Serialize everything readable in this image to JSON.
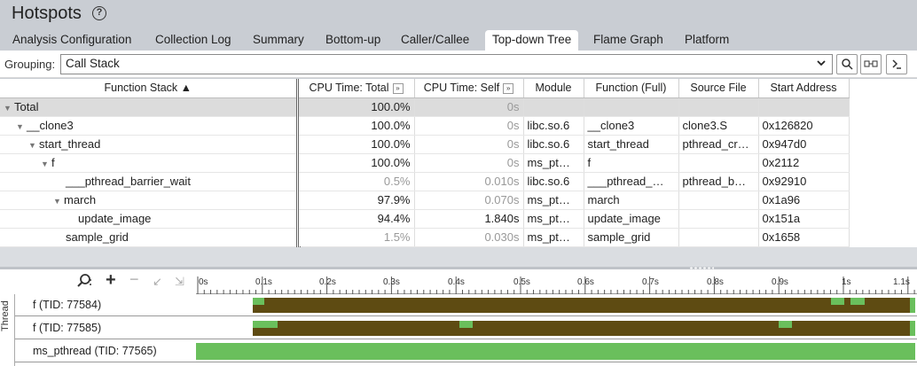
{
  "app": {
    "title": "Hotspots",
    "help_icon": "?"
  },
  "tabs": [
    {
      "label": "Analysis Configuration"
    },
    {
      "label": "Collection Log"
    },
    {
      "label": "Summary"
    },
    {
      "label": "Bottom-up"
    },
    {
      "label": "Caller/Callee"
    },
    {
      "label": "Top-down Tree",
      "active": true
    },
    {
      "label": "Flame Graph"
    },
    {
      "label": "Platform"
    }
  ],
  "grouping": {
    "label": "Grouping:",
    "value": "Call Stack"
  },
  "grid": {
    "columns": [
      "Function Stack ▲",
      "CPU Time: Total",
      "CPU Time: Self",
      "Module",
      "Function (Full)",
      "Source File",
      "Start Address"
    ],
    "expand_glyph": "»",
    "rows": [
      {
        "name": "Total",
        "total": "100.0%",
        "self": "0s",
        "module": "",
        "function": "",
        "source": "",
        "address": ""
      },
      {
        "name": "__clone3",
        "total": "100.0%",
        "self": "0s",
        "module": "libc.so.6",
        "function": "__clone3",
        "source": "clone3.S",
        "address": "0x126820"
      },
      {
        "name": "start_thread",
        "total": "100.0%",
        "self": "0s",
        "module": "libc.so.6",
        "function": "start_thread",
        "source": "pthread_cr…",
        "address": "0x947d0"
      },
      {
        "name": "f",
        "total": "100.0%",
        "self": "0s",
        "module": "ms_pt…",
        "function": "f",
        "source": "",
        "address": "0x2112"
      },
      {
        "name": "___pthread_barrier_wait",
        "total": "0.5%",
        "self": "0.010s",
        "module": "libc.so.6",
        "function": "___pthread_…",
        "source": "pthread_b…",
        "address": "0x92910"
      },
      {
        "name": "march",
        "total": "97.9%",
        "self": "0.070s",
        "module": "ms_pt…",
        "function": "march",
        "source": "",
        "address": "0x1a96"
      },
      {
        "name": "update_image",
        "total": "94.4%",
        "self": "1.840s",
        "module": "ms_pt…",
        "function": "update_image",
        "source": "",
        "address": "0x151a"
      },
      {
        "name": "sample_grid",
        "total": "1.5%",
        "self": "0.030s",
        "module": "ms_pt…",
        "function": "sample_grid",
        "source": "",
        "address": "0x1658"
      }
    ]
  },
  "timeline": {
    "axis_label": "Thread",
    "ticks": [
      "0s",
      "0.1s",
      "0.2s",
      "0.3s",
      "0.4s",
      "0.5s",
      "0.6s",
      "0.7s",
      "0.8s",
      "0.9s",
      "1s",
      "1.1s"
    ],
    "threads": [
      {
        "label": "f (TID: 77584)"
      },
      {
        "label": "f (TID: 77585)"
      },
      {
        "label": "ms_pthread (TID: 77565)"
      }
    ],
    "colors": {
      "running": "#5e4b12",
      "cpu": "#6abf5c"
    }
  }
}
